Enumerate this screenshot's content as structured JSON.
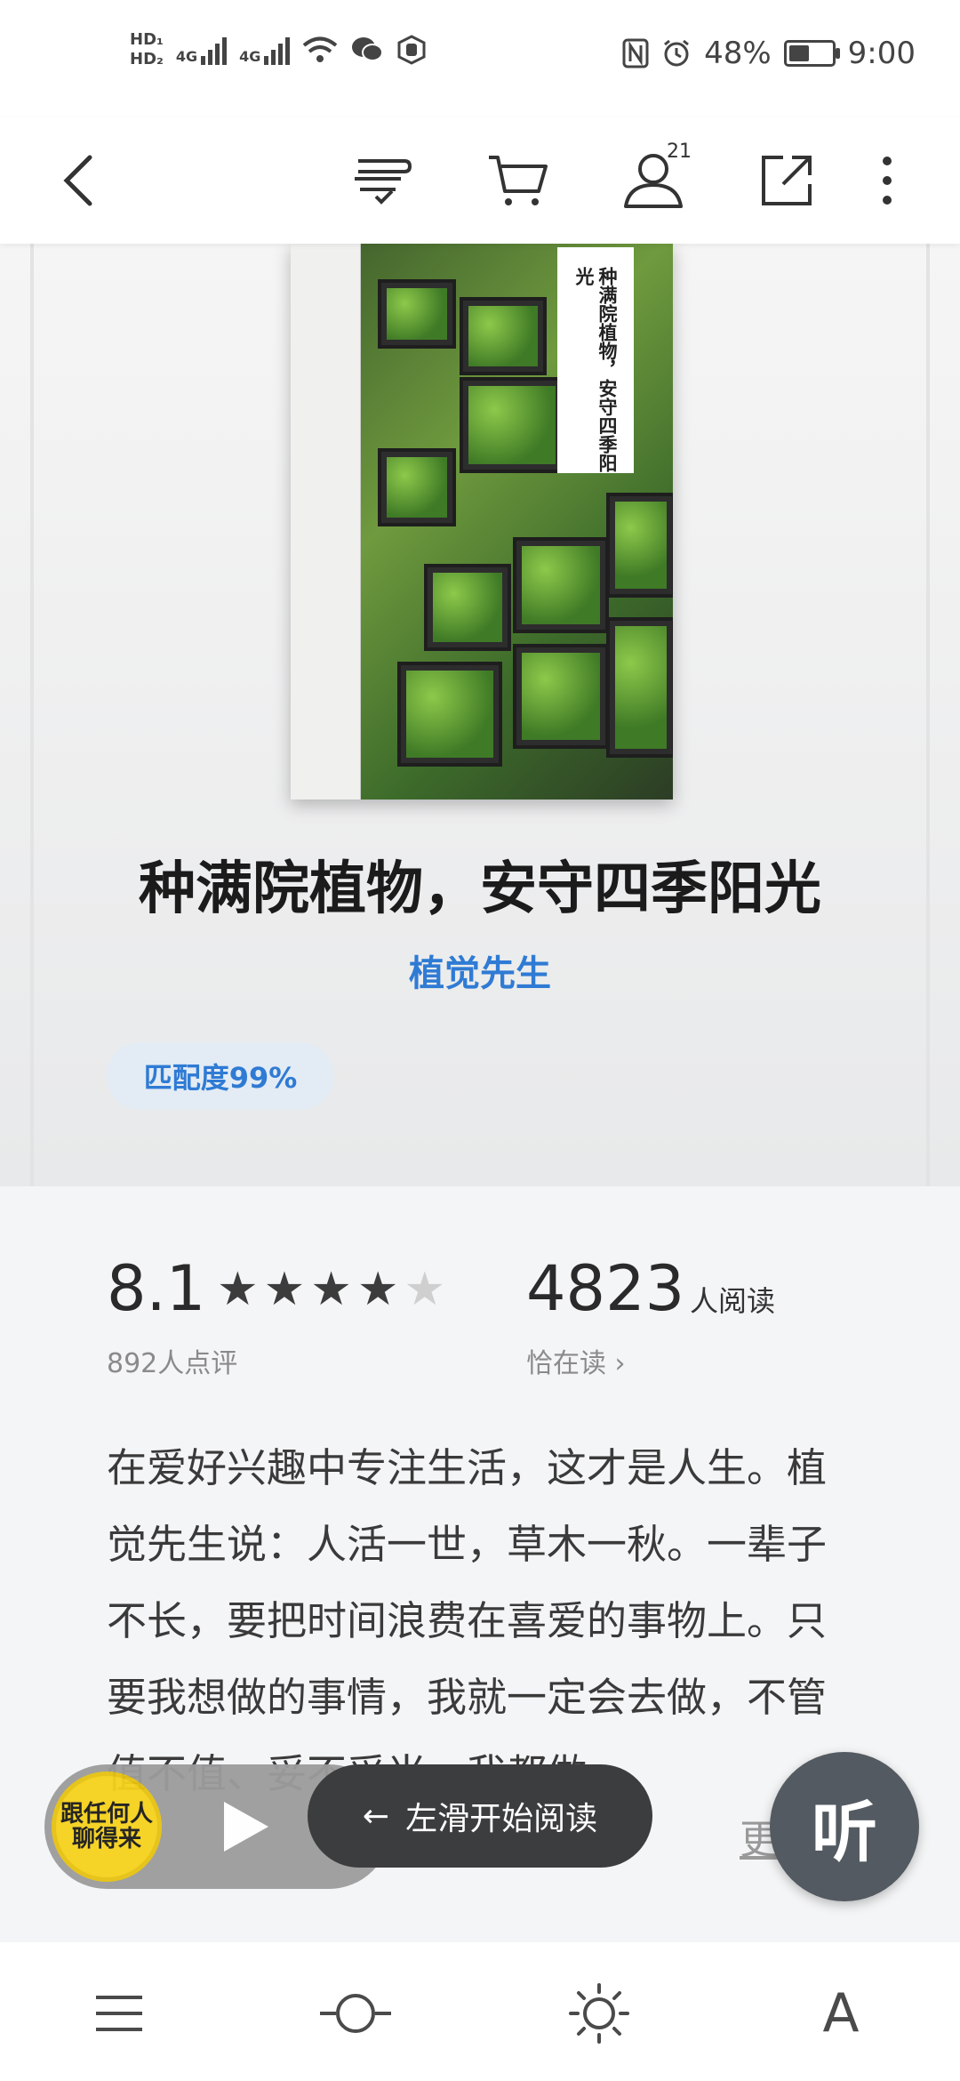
{
  "status_bar": {
    "hd1": "HD₁",
    "hd2": "HD₂",
    "signal1": "4G",
    "signal2": "4G",
    "battery": "48%",
    "battery_level": 0.48,
    "time": "9:00"
  },
  "toolbar": {
    "friends_badge": "21",
    "icons": [
      "back-icon",
      "bookmark-list-icon",
      "cart-icon",
      "user-icon",
      "share-icon",
      "more-icon"
    ]
  },
  "book": {
    "title": "种满院植物，安守四季阳光",
    "author": "植觉先生",
    "cover_title": "种满院植物，安守四季阳光",
    "match": "匹配度99%"
  },
  "stats": {
    "rating": "8.1",
    "stars": 4,
    "rating_count": "892人点评",
    "readers": "4823",
    "readers_unit": "人阅读",
    "reading_now": "恰在读",
    "reading_now_chevron": "›"
  },
  "description": {
    "text": "在爱好兴趣中专注生活，这才是人生。植觉先生说：人活一世，草木一秋。一辈子不长，要把时间浪费在喜爱的事物上。只要我想做的事情，我就一定会去做，不管值不值、妥不妥当，我都做。",
    "more": "更"
  },
  "player": {
    "mini_cover_text": "跟任何人聊得来"
  },
  "swipe_tip": {
    "arrow": "←",
    "label": "左滑开始阅读"
  },
  "listen_button": {
    "label": "听"
  },
  "bottom_bar": {
    "font_label": "A",
    "icons": [
      "menu-icon",
      "progress-icon",
      "brightness-icon",
      "font-icon"
    ]
  }
}
